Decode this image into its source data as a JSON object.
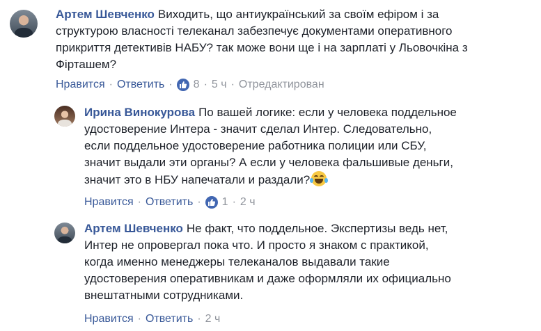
{
  "comments": [
    {
      "author": "Артем Шевченко",
      "lines": [
        "Виходить, що антиукраїнський за своїм ефіром і за",
        "структурою власності телеканал забезпечує документами оперативного",
        "прикриття детективів НАБУ? так може вони ще і на зарплаті у Льовочкіна з",
        "Фірташем?"
      ],
      "like_label": "Нравится",
      "reply_label": "Ответить",
      "reactions_count": "8",
      "time": "5 ч",
      "edited_label": "Отредактирован"
    },
    {
      "author": "Ирина Винокурова",
      "lines": [
        "По вашей логике: если у человека поддельное",
        "удостоверение Интера - значит сделал Интер. Следовательно,",
        "если поддельное удостоверение работника полиции или СБУ,",
        "значит выдали эти органы? А если у человека фальшивые деньги,",
        "значит это в НБУ напечатали и раздали?"
      ],
      "emoji": "tears-of-joy",
      "like_label": "Нравится",
      "reply_label": "Ответить",
      "reactions_count": "1",
      "time": "2 ч"
    },
    {
      "author": "Артем Шевченко",
      "lines": [
        "Не факт, что поддельное. Экспертизы ведь нет,",
        "Интер не опровергал пока что. И просто я знаком с практикой,",
        "когда именно менеджеры телеканалов выдавали такие",
        "удостоверения оперативникам и даже оформляли их официально",
        "внештатными сотрудниками."
      ],
      "like_label": "Нравится",
      "reply_label": "Ответить",
      "time": "2 ч"
    }
  ],
  "colors": {
    "link": "#385898",
    "text": "#1d2129",
    "meta": "#90949c",
    "like_badge": "#4267b2"
  }
}
